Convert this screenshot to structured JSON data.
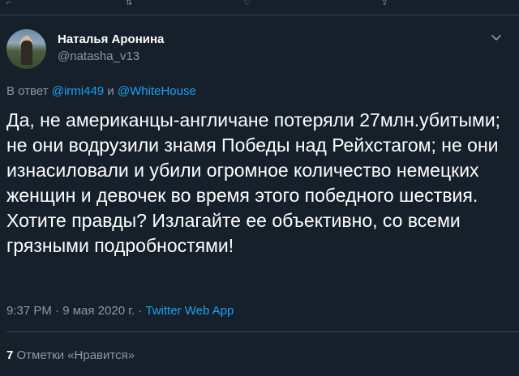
{
  "tweet": {
    "display_name": "Наталья Аронина",
    "handle": "@natasha_v13",
    "reply_prefix": "В ответ",
    "reply_mention_1": "@irmi449",
    "reply_conjunction": "и",
    "reply_mention_2": "@WhiteHouse",
    "text": "Да, не американцы-англичане потеряли 27млн.убитыми; не они водрузили знамя Победы над Рейхстагом; не они изнасиловали и убили огромное количество немецких женщин и девочек во время этого победного шествия. Хотите правды? Излагайте ее объективно, со всеми грязными подробностями!",
    "time": "9:37 PM",
    "separator": "·",
    "date": "9 мая 2020 г.",
    "app": "Twitter Web App",
    "likes_count": "7",
    "likes_label": "Отметки «Нравится»"
  },
  "icons": {
    "avatar": "avatar-photo",
    "more": "chevron-down-icon"
  },
  "colors": {
    "background": "#15202b",
    "text_primary": "#ffffff",
    "text_secondary": "#8899a6",
    "link": "#1da1f2",
    "border": "#38444d"
  }
}
